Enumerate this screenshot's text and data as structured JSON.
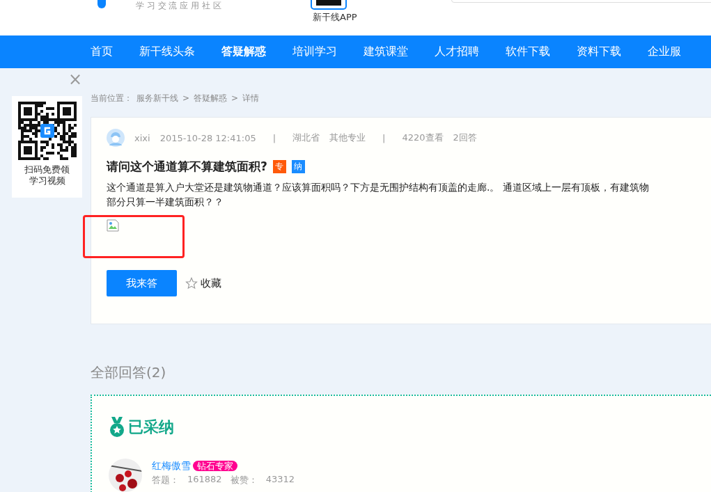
{
  "header": {
    "tagline": "学 习 交 流 应 用 社 区",
    "app_label": "新干线APP"
  },
  "nav": [
    {
      "label": "首页",
      "selected": false
    },
    {
      "label": "新干线头条",
      "selected": false
    },
    {
      "label": "答疑解惑",
      "selected": true
    },
    {
      "label": "培训学习",
      "selected": false
    },
    {
      "label": "建筑课堂",
      "selected": false
    },
    {
      "label": "人才招聘",
      "selected": false
    },
    {
      "label": "软件下载",
      "selected": false
    },
    {
      "label": "资料下载",
      "selected": false
    },
    {
      "label": "企业服",
      "selected": false
    }
  ],
  "qr_widget": {
    "caption": [
      "扫码免费领",
      "学习视频"
    ],
    "close": "×"
  },
  "breadcrumb": {
    "label": "当前位置：",
    "items": [
      "服务新干线",
      "答疑解惑",
      "详情"
    ],
    "separator": ">"
  },
  "question": {
    "user": "xixi",
    "time": "2015-10-28 12:41:05",
    "region": "湖北省",
    "category": "其他专业",
    "separator": "|",
    "views": "4220查看",
    "answers": "2回答",
    "title": "请问这个通道算不算建筑面积?",
    "tags": [
      {
        "label": "专",
        "color": "#ff5a0a"
      },
      {
        "label": "纳",
        "color": "#1a8cff"
      }
    ],
    "body": [
      "这个通道是算入户大堂还是建筑物通道？应该算面积吗？下方是无围护结构有顶盖的走廊.。 通道区域上一层有顶板，有建筑物",
      "部分只算一半建筑面积？？"
    ],
    "answer_button": "我来答",
    "favorite": "收藏"
  },
  "answers_heading": "全部回答(2)",
  "accepted": {
    "title": "已采纳",
    "user": "红梅傲雪",
    "badge": "钻石专家",
    "stats": [
      {
        "label": "答题：",
        "value": "161882"
      },
      {
        "label": "被赞：",
        "value": "43312"
      }
    ]
  }
}
